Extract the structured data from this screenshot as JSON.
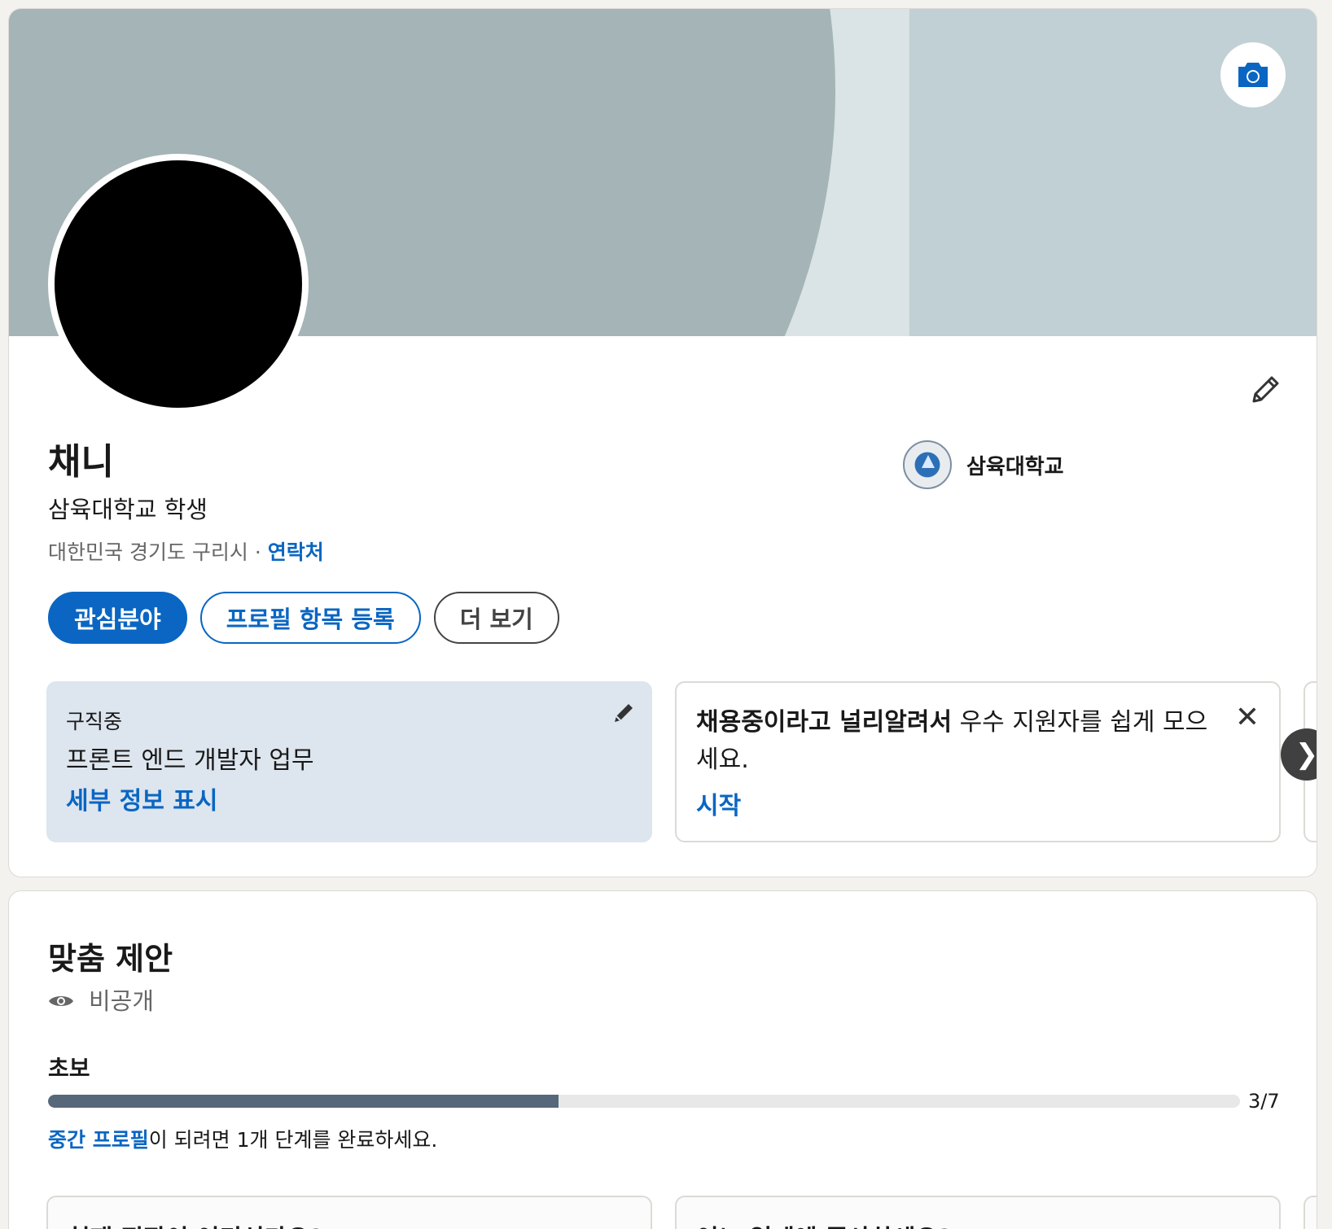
{
  "profile": {
    "name": "채니",
    "headline": "삼육대학교 학생",
    "location": "대한민국 경기도 구리시",
    "separator": "·",
    "contact_link": "연락처",
    "school": "삼육대학교",
    "buttons": {
      "interests": "관심분야",
      "add_section": "프로필 항목 등록",
      "more": "더 보기"
    },
    "open_to_work": {
      "label": "구직중",
      "value": "프론트 엔드 개발자 업무",
      "link": "세부 정보 표시"
    },
    "hiring": {
      "bold": "채용중이라고 널리알려서",
      "text": " 우수 지원자를 쉽게 모으세요.",
      "start": "시작",
      "close": "✕"
    },
    "next": "❯"
  },
  "suggestions": {
    "title": "맞춤 제안",
    "visibility": "비공개",
    "level": "초보",
    "progress": {
      "current": 3,
      "total": 7,
      "fraction": 0.4286,
      "label": "3/7"
    },
    "hint_link": "중간 프로필",
    "hint_text": "이 되려면 1개 단계를 완료하세요.",
    "cards": [
      {
        "question": "현재 직장이 어디신가요?"
      },
      {
        "question": "어느 업계에 종사하세요?"
      }
    ]
  },
  "colors": {
    "accent": "#0a66c2",
    "banner_dark": "#a5b4b6",
    "banner_light": "#dae3e5",
    "banner_right": "#c0d0d4",
    "open_card_bg": "#dde5ee",
    "progress_fill": "#56687a"
  },
  "icons": {
    "camera": "camera-icon",
    "edit": "pencil-icon",
    "eye": "eye-icon",
    "close": "close-icon",
    "next": "chevron-right-icon"
  }
}
